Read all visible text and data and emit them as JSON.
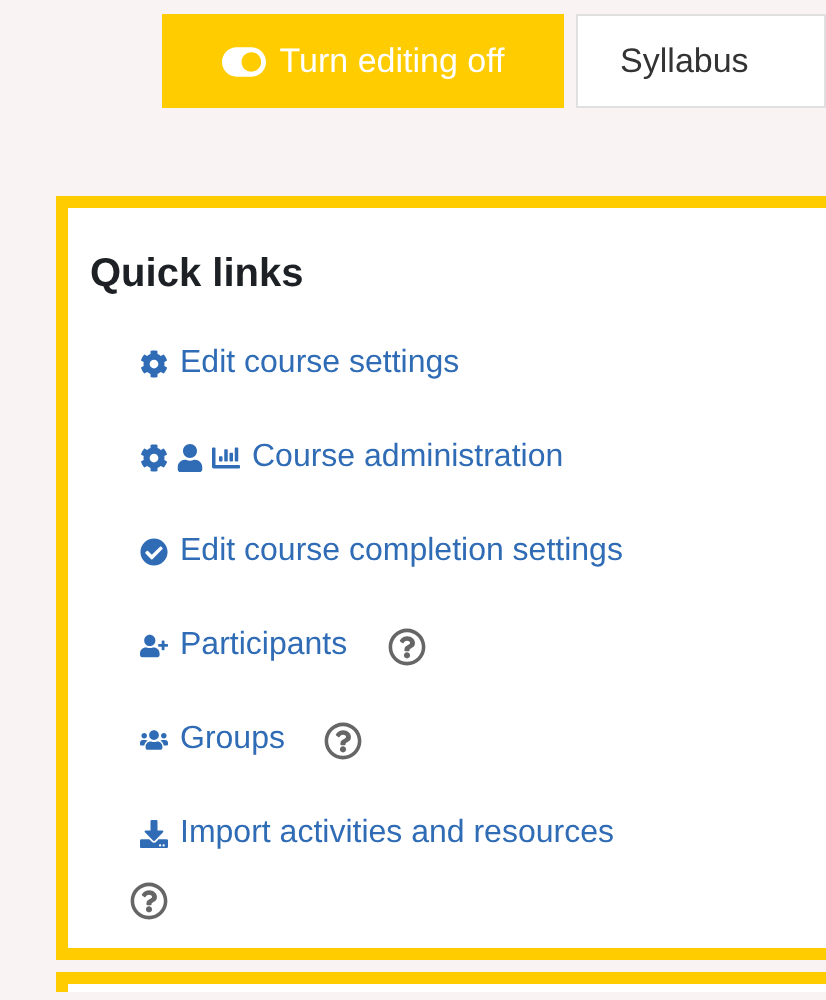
{
  "toolbar": {
    "edit_button": {
      "label": "Turn editing off",
      "on": true
    },
    "syllabus_button": {
      "label": "Syllabus"
    }
  },
  "quick_links": {
    "title": "Quick links",
    "links": [
      {
        "label": "Edit course settings",
        "kind": "settings",
        "help": false
      },
      {
        "label": "Course administration",
        "kind": "administration",
        "help": false
      },
      {
        "label": "Edit course completion settings",
        "kind": "completion",
        "help": false
      },
      {
        "label": "Participants",
        "kind": "participants",
        "help": true
      },
      {
        "label": "Groups",
        "kind": "groups",
        "help": true
      },
      {
        "label": "Import activities and resources",
        "kind": "import",
        "help": true
      }
    ]
  }
}
